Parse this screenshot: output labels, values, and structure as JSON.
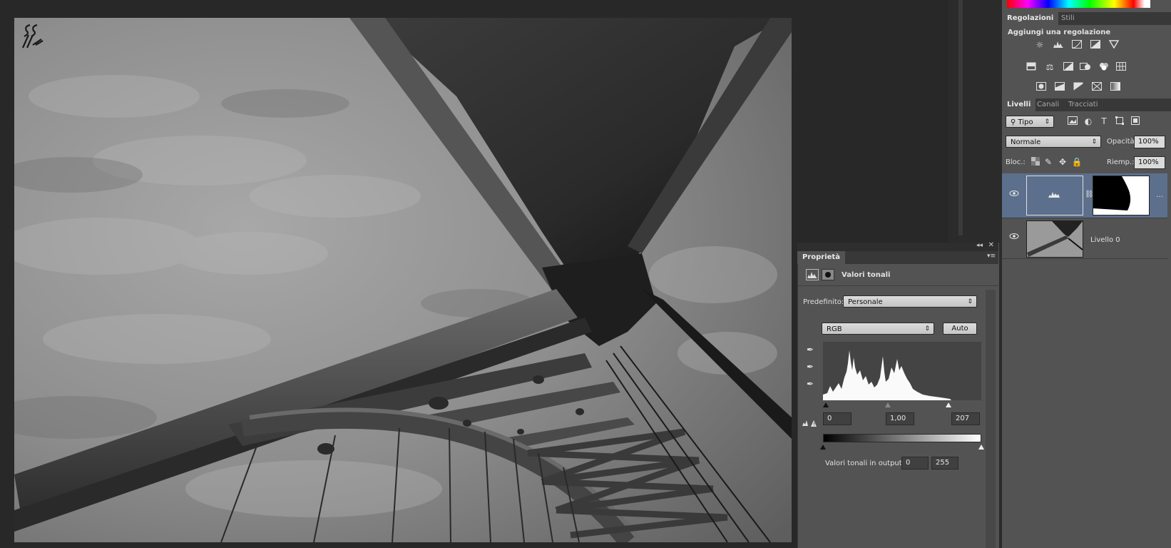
{
  "adjustments_panel": {
    "tabs": [
      "Regolazioni",
      "Stili"
    ],
    "title": "Aggiungi una regolazione",
    "icons_row1": [
      "brightness-icon",
      "levels-icon",
      "curves-icon",
      "exposure-icon",
      "vibrance-icon"
    ],
    "icons_row2": [
      "hue-saturation-icon",
      "color-balance-icon",
      "black-white-icon",
      "photo-filter-icon",
      "channel-mixer-icon",
      "color-lookup-icon"
    ],
    "icons_row3": [
      "invert-icon",
      "posterize-icon",
      "threshold-icon",
      "selective-color-icon",
      "gradient-map-icon"
    ]
  },
  "layers_panel": {
    "tabs": [
      "Livelli",
      "Canali",
      "Tracciati"
    ],
    "filter_type": "Tipo",
    "blend_mode": "Normale",
    "opacity_label": "Opacità:",
    "opacity_value": "100%",
    "lock_label": "Bloc.:",
    "fill_label": "Riemp.:",
    "fill_value": "100%",
    "layers": [
      {
        "name": "",
        "type": "adjustment-levels",
        "selected": true
      },
      {
        "name": "Livello 0",
        "type": "image",
        "selected": false
      }
    ]
  },
  "properties_panel": {
    "tab": "Proprietà",
    "title": "Valori tonali",
    "preset_label": "Predefinito:",
    "preset_value": "Personale",
    "channel_value": "RGB",
    "auto_label": "Auto",
    "input_black": "0",
    "input_gamma": "1,00",
    "input_white": "207",
    "output_label": "Valori tonali in output:",
    "output_black": "0",
    "output_white": "255"
  },
  "colors": {
    "panel_bg": "#535353",
    "app_bg": "#282828",
    "selected_layer": "#5c6f8c"
  }
}
